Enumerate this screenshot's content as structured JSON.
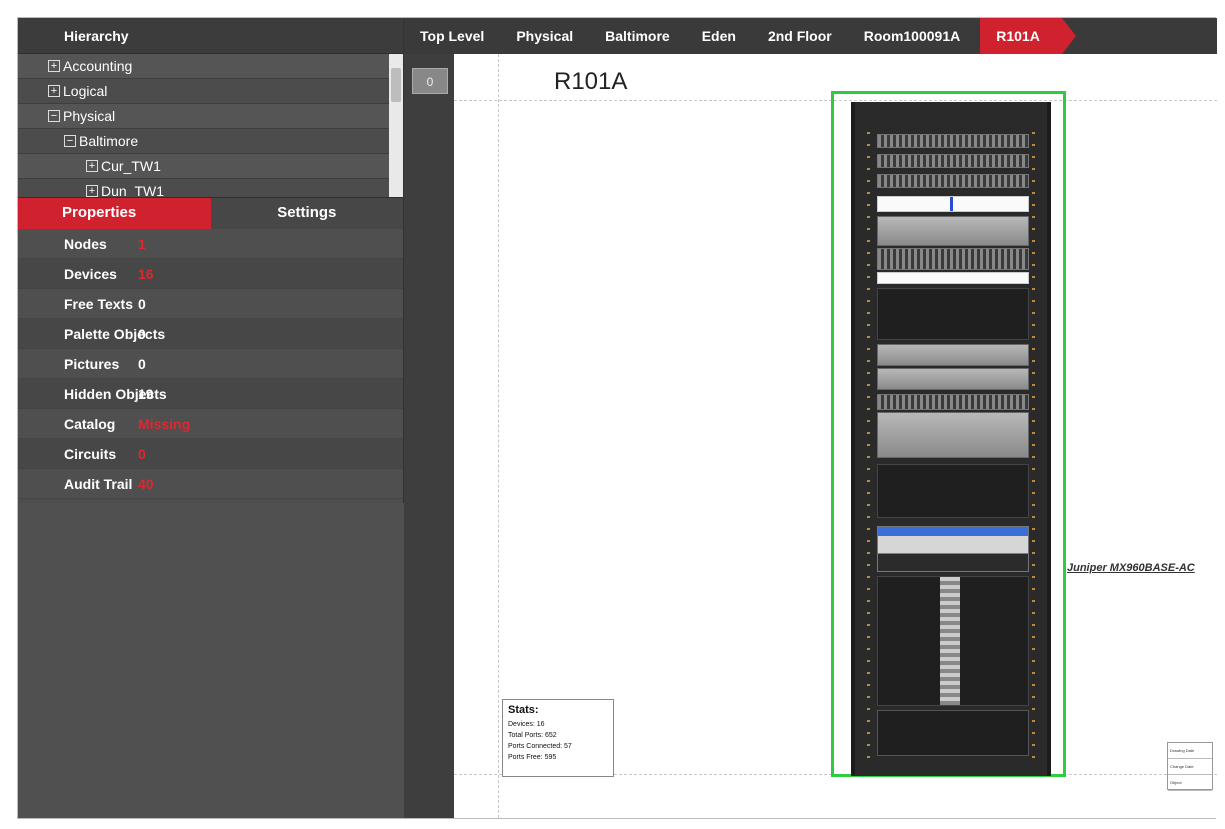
{
  "hierarchy": {
    "title": "Hierarchy",
    "items": [
      {
        "label": "Accounting",
        "toggle": "+",
        "depth": 0
      },
      {
        "label": "Logical",
        "toggle": "+",
        "depth": 0
      },
      {
        "label": "Physical",
        "toggle": "−",
        "depth": 0
      },
      {
        "label": "Baltimore",
        "toggle": "−",
        "depth": 1
      },
      {
        "label": "Cur_TW1",
        "toggle": "+",
        "depth": 2
      },
      {
        "label": "Dun_TW1",
        "toggle": "+",
        "depth": 2
      }
    ]
  },
  "tabs": {
    "properties": "Properties",
    "settings": "Settings"
  },
  "properties": [
    {
      "label": "Nodes",
      "value": "1"
    },
    {
      "label": "Devices",
      "value": "16"
    },
    {
      "label": "Free Texts",
      "value": "0"
    },
    {
      "label": "Palette Objects",
      "value": "0"
    },
    {
      "label": "Pictures",
      "value": "0"
    },
    {
      "label": "Hidden Objects",
      "value": "19"
    },
    {
      "label": "Catalog",
      "value": "Missing"
    },
    {
      "label": "Circuits",
      "value": "0"
    },
    {
      "label": "Audit Trail",
      "value": "40"
    }
  ],
  "breadcrumb": [
    "Top Level",
    "Physical",
    "Baltimore",
    "Eden",
    "2nd Floor",
    "Room100091A",
    "R101A"
  ],
  "canvas": {
    "zoom": "0",
    "room_title": "R101A",
    "device_label": "Juniper MX960BASE-AC",
    "stats": {
      "title": "Stats:",
      "devices": "Devices: 16",
      "total_ports": "Total Ports: 652",
      "ports_connected": "Ports Connected: 57",
      "ports_free": "Ports Free: 595"
    },
    "legend": [
      "Drawing Date",
      "Change Date",
      "Object"
    ]
  },
  "colors": {
    "accent": "#d0212f",
    "rack_outline": "#2ecc40",
    "panel_bg": "#4d4d4d"
  }
}
